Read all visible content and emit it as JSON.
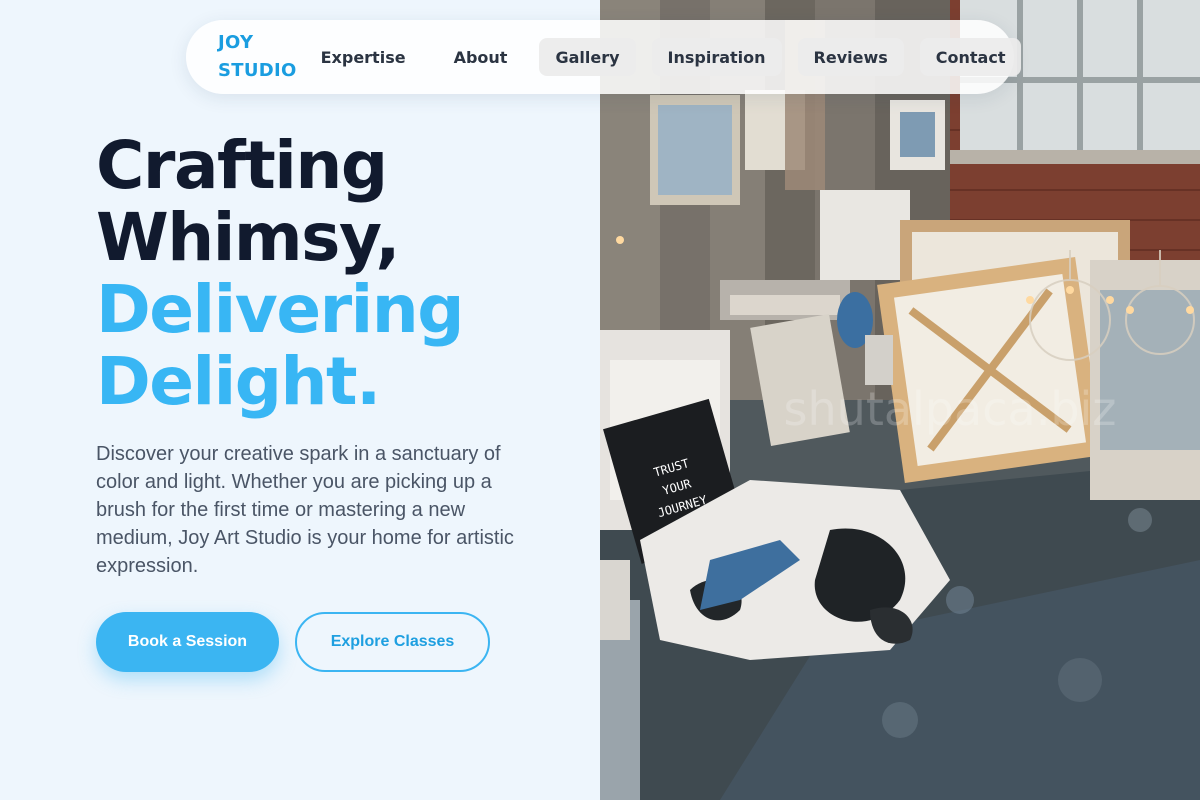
{
  "brand": {
    "line1": "JOY",
    "line2": "STUDIO"
  },
  "nav": {
    "items": [
      {
        "label": "Expertise"
      },
      {
        "label": "About"
      },
      {
        "label": "Gallery"
      },
      {
        "label": "Inspiration"
      },
      {
        "label": "Reviews"
      },
      {
        "label": "Contact"
      }
    ]
  },
  "hero": {
    "headline_line1": "Crafting",
    "headline_line2": "Whimsy,",
    "headline_line3": "Delivering",
    "headline_line4": "Delight.",
    "description": "Discover your creative spark in a sanctuary of color and light. Whether you are picking up a brush for the first time or mastering a new medium, Joy Art Studio is your home for artistic expression.",
    "primary_cta": "Book a Session",
    "secondary_cta": "Explore Classes"
  },
  "photo": {
    "sign_text": "TRUST YOUR JOURNEY",
    "watermark": "shutalpaca.biz"
  },
  "colors": {
    "accent": "#38b6f4",
    "brand": "#1a9de0",
    "headline_dark": "#111a2e",
    "background": "#eef6fd",
    "body_text": "#4a5566"
  }
}
